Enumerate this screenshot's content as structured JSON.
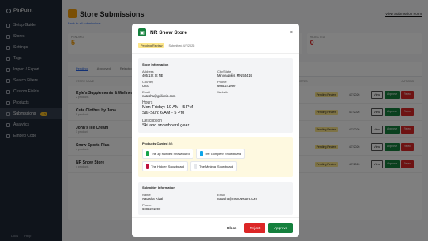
{
  "app": {
    "name": "PinPoint"
  },
  "sidebar": {
    "items": [
      {
        "label": "Setup Guide",
        "icon": "rocket-icon"
      },
      {
        "label": "Stores",
        "icon": "store-icon"
      },
      {
        "label": "Settings",
        "icon": "gear-icon"
      },
      {
        "label": "Tags",
        "icon": "tag-icon"
      },
      {
        "label": "Import / Export",
        "icon": "import-icon"
      },
      {
        "label": "Search Filters",
        "icon": "filter-icon"
      },
      {
        "label": "Custom Fields",
        "icon": "fields-icon"
      },
      {
        "label": "Products",
        "icon": "box-icon"
      },
      {
        "label": "Submissions",
        "icon": "inbox-icon",
        "badge": "12"
      },
      {
        "label": "Analytics",
        "icon": "chart-icon"
      },
      {
        "label": "Embed Code",
        "icon": "code-icon"
      }
    ],
    "footer": {
      "left": "Docs",
      "right": "Help"
    }
  },
  "page": {
    "title": "Store Submissions",
    "view_form": "View Submission Form",
    "back": "Back to all submissions",
    "stats": [
      {
        "label": "PENDING",
        "value": "5"
      },
      {
        "label": "",
        "value": ""
      },
      {
        "label": "REJECTED",
        "value": "0"
      }
    ],
    "tabs": [
      "Pending",
      "Approved",
      "Rejected"
    ],
    "table_headers": {
      "name": "STORE NAME",
      "status": "STATUS",
      "submitted": "SUBMITTED",
      "actions": "ACTIONS"
    },
    "rows": [
      {
        "name": "Kyle's Supplements & Wellness Store",
        "sub": "2 products",
        "status": "Pending Review",
        "date": "4/7/2026"
      },
      {
        "name": "Cute Clothes by Jana",
        "sub": "5 products",
        "status": "Pending Review",
        "date": "4/7/2026"
      },
      {
        "name": "John's Ice Cream",
        "sub": "1 product",
        "status": "Pending Review",
        "date": "4/7/2026"
      },
      {
        "name": "Snow Sports Plus",
        "sub": "4 products",
        "status": "Pending Review",
        "date": "4/7/2026"
      },
      {
        "name": "NR Snow Store",
        "sub": "4 products",
        "status": "Pending Review",
        "date": "4/7/2026"
      }
    ],
    "row_actions": {
      "view": "View",
      "approve": "Approve",
      "reject": "Reject"
    }
  },
  "modal": {
    "title": "NR Snow Store",
    "close_icon": "×",
    "status_badge": "Pending Review",
    "submitted": "Submitted 4/7/2026",
    "store_info": {
      "heading": "Store Information",
      "address_label": "Address",
      "address": "405 1St St NE",
      "city_label": "City/State",
      "city": "Minneapolis, MN 55414",
      "country_label": "Country",
      "country": "USA",
      "phone_label": "Phone",
      "phone": "6086221090",
      "email_label": "Email",
      "email": "natasha@grilionis.com",
      "website_label": "Website",
      "website": "-",
      "hours_label": "Hours",
      "hours_line1": "Mon-Friday: 10 AM - 5 PM",
      "hours_line2": "Sat-Sun: 6 AM - 5 PM",
      "description_label": "Description",
      "description": "Ski and snowboard gear."
    },
    "products": {
      "heading": "Products Carried (4)",
      "items": [
        {
          "name": "The 3p Fulfilled Snowboard",
          "color": "#16a34a"
        },
        {
          "name": "The Complete Snowboard",
          "color": "#0ea5e9"
        },
        {
          "name": "The Hidden Snowboard",
          "color": "#be123c"
        },
        {
          "name": "The Minimal Snowboard",
          "color": "#e5e7eb"
        }
      ]
    },
    "submitter": {
      "heading": "Submitter Information",
      "name_label": "Name",
      "name": "Natasha Rizal",
      "email_label": "Email",
      "email": "natasha@nrsnowstore.com",
      "phone_label": "Phone",
      "phone": "6086221090"
    },
    "buttons": {
      "close": "Close",
      "reject": "Reject",
      "approve": "Approve"
    }
  }
}
